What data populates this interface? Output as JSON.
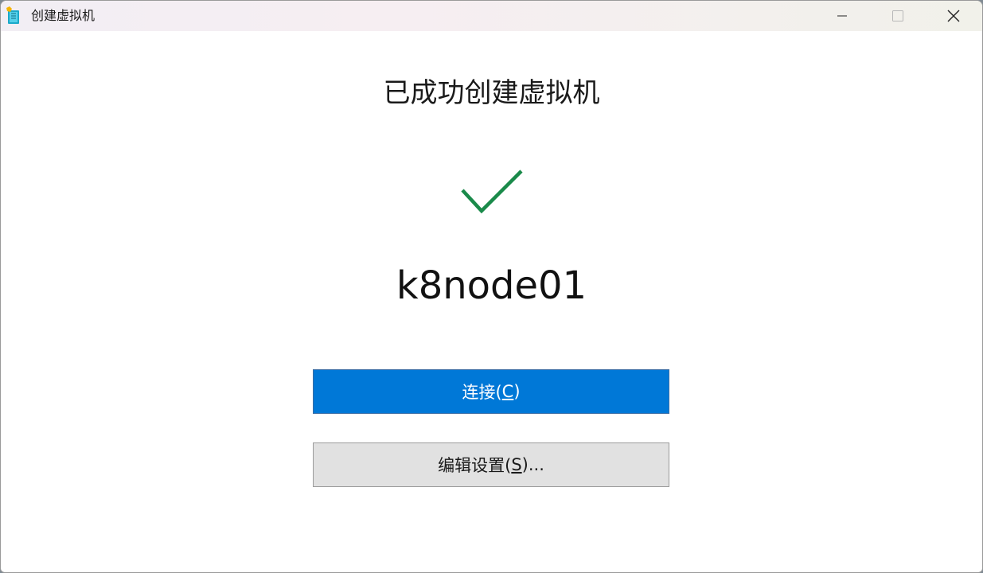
{
  "window": {
    "title": "创建虚拟机",
    "controls": {
      "minimize": "minimize",
      "maximize": "maximize",
      "close": "close"
    }
  },
  "main": {
    "heading": "已成功创建虚拟机",
    "status_icon": "checkmark-icon",
    "status_color": "#1a8a4a",
    "vm_name": "k8node01"
  },
  "buttons": {
    "connect": {
      "label": "连接(",
      "mnemonic": "C",
      "suffix": ")",
      "color": "#0078d7"
    },
    "edit_settings": {
      "label": "编辑设置(",
      "mnemonic": "S",
      "suffix": ")..."
    }
  }
}
